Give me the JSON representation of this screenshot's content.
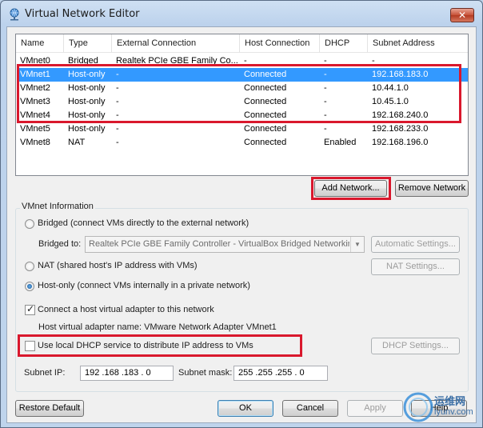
{
  "window": {
    "title": "Virtual Network Editor",
    "close_glyph": "✕",
    "icon": "network-globe-icon"
  },
  "table": {
    "columns": [
      "Name",
      "Type",
      "External Connection",
      "Host Connection",
      "DHCP",
      "Subnet Address"
    ],
    "rows": [
      [
        "VMnet0",
        "Bridged",
        "Realtek PCIe GBE Family Co...",
        "-",
        "-",
        "-"
      ],
      [
        "VMnet1",
        "Host-only",
        "-",
        "Connected",
        "-",
        "192.168.183.0"
      ],
      [
        "VMnet2",
        "Host-only",
        "-",
        "Connected",
        "-",
        "10.44.1.0"
      ],
      [
        "VMnet3",
        "Host-only",
        "-",
        "Connected",
        "-",
        "10.45.1.0"
      ],
      [
        "VMnet4",
        "Host-only",
        "-",
        "Connected",
        "-",
        "192.168.240.0"
      ],
      [
        "VMnet5",
        "Host-only",
        "-",
        "Connected",
        "-",
        "192.168.233.0"
      ],
      [
        "VMnet8",
        "NAT",
        "-",
        "Connected",
        "Enabled",
        "192.168.196.0"
      ]
    ],
    "selected_row": "VMnet1"
  },
  "buttons": {
    "add_network": "Add Network...",
    "remove_network": "Remove Network",
    "automatic_settings": "Automatic Settings...",
    "nat_settings": "NAT Settings...",
    "dhcp_settings": "DHCP Settings...",
    "restore_default": "Restore Default",
    "ok": "OK",
    "cancel": "Cancel",
    "apply": "Apply",
    "help": "Help"
  },
  "vmnet_info": {
    "legend": "VMnet Information",
    "bridged_label": "Bridged (connect VMs directly to the external network)",
    "bridged_to_label": "Bridged to:",
    "bridged_to_value": "Realtek PCIe GBE Family Controller - VirtualBox Bridged Networking D",
    "nat_label": "NAT (shared host's IP address with VMs)",
    "hostonly_label": "Host-only (connect VMs internally in a private network)",
    "selected_mode": "host-only",
    "connect_adapter_label": "Connect a host virtual adapter to this network",
    "connect_adapter_checked": true,
    "adapter_name_text": "Host virtual adapter name: VMware Network Adapter VMnet1",
    "use_dhcp_label": "Use local DHCP service to distribute IP address to VMs",
    "use_dhcp_checked": false
  },
  "subnet": {
    "ip_label": "Subnet IP:",
    "ip_value": "192 .168 .183 .  0",
    "mask_label": "Subnet mask:",
    "mask_value": "255 .255 .255 .  0"
  },
  "watermark": {
    "line1": "运维网",
    "line2": "iyunv.com"
  },
  "colors": {
    "selection": "#3399ff",
    "highlight_box": "#d9182d"
  }
}
